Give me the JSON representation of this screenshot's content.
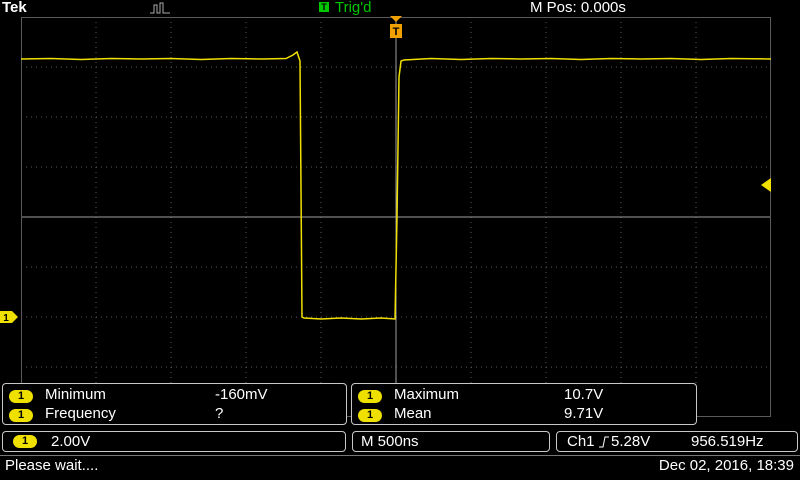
{
  "header": {
    "brand": "Tek",
    "acquisition_icon": "waveform-acquire-icon",
    "trigger_badge": "T",
    "trigger_status": "Trig'd",
    "horizontal_position": "M Pos: 0.000s"
  },
  "colors": {
    "channel1": "#f0e000",
    "trigger_status": "#00c800",
    "grid": "#5a5a5a",
    "background": "#000000"
  },
  "markers": {
    "channel": "1",
    "trigger": "T"
  },
  "measurements": {
    "left": [
      {
        "channel": "1",
        "label": "Minimum",
        "value": "-160mV"
      },
      {
        "channel": "1",
        "label": "Frequency",
        "value": "?"
      }
    ],
    "right": [
      {
        "channel": "1",
        "label": "Maximum",
        "value": "10.7V"
      },
      {
        "channel": "1",
        "label": "Mean",
        "value": "9.71V"
      }
    ]
  },
  "status": {
    "channel": "1",
    "vertical_scale": "2.00V",
    "timebase": "M 500ns",
    "trigger_source": "Ch1",
    "trigger_slope_icon": "rising-edge-icon",
    "trigger_level": "5.28V",
    "trigger_frequency": "956.519Hz"
  },
  "message": "Please wait....",
  "datetime": "Dec 02, 2016, 18:39"
}
